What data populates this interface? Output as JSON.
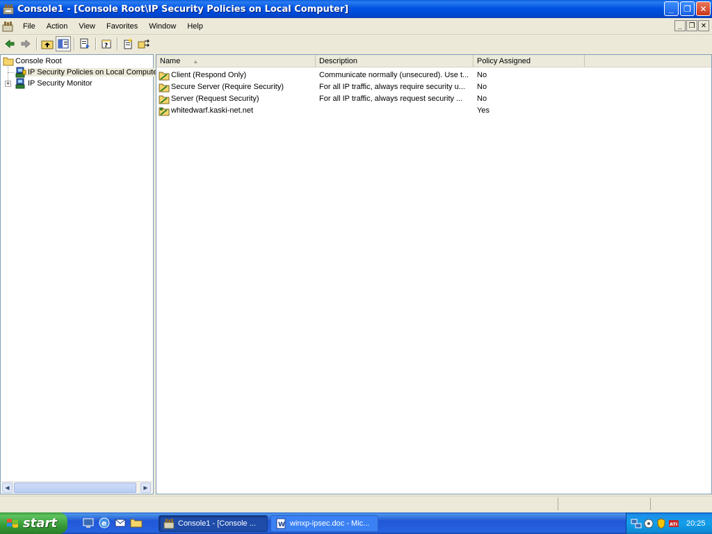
{
  "window": {
    "title": "Console1 - [Console Root\\IP Security Policies on Local Computer]",
    "buttons": {
      "minimize": "_",
      "maximize": "❐",
      "close": "✕"
    }
  },
  "menu": {
    "items": [
      "File",
      "Action",
      "View",
      "Favorites",
      "Window",
      "Help"
    ],
    "child_buttons": {
      "minimize": "_",
      "restore": "❐",
      "close": "✕"
    }
  },
  "toolbar": {
    "icons": [
      "back-icon",
      "forward-icon",
      "up-level-icon",
      "show-hide-tree-icon",
      "export-list-icon",
      "help-icon",
      "create-policy-icon",
      "manage-filters-icon"
    ]
  },
  "tree": {
    "items": [
      {
        "label": "Console Root",
        "icon": "folder-icon"
      },
      {
        "label": "IP Security Policies on Local Compute",
        "icon": "ipsec-policies-icon",
        "selected": true
      },
      {
        "label": "IP Security Monitor",
        "icon": "ipsec-monitor-icon",
        "expander": "+"
      }
    ]
  },
  "list": {
    "columns": [
      {
        "label": "Name",
        "sort": "▲"
      },
      {
        "label": "Description"
      },
      {
        "label": "Policy Assigned"
      }
    ],
    "rows": [
      {
        "name": "Client (Respond Only)",
        "description": "Communicate normally (unsecured). Use t...",
        "assigned": "No"
      },
      {
        "name": "Secure Server (Require Security)",
        "description": "For all IP traffic, always require security u...",
        "assigned": "No"
      },
      {
        "name": "Server (Request Security)",
        "description": "For all IP traffic, always request security ...",
        "assigned": "No"
      },
      {
        "name": "whitedwarf.kaski-net.net",
        "description": "",
        "assigned": "Yes"
      }
    ]
  },
  "taskbar": {
    "start_label": "start",
    "tasks": [
      {
        "label": "Console1 - [Console ...",
        "active": true
      },
      {
        "label": "winxp-ipsec.doc - Mic...",
        "active": false
      }
    ],
    "quick_launch": [
      "desktop-icon",
      "ie-icon",
      "outlook-icon",
      "explorer-icon"
    ],
    "tray_icons": [
      "network-icon",
      "volume-icon",
      "security-icon",
      "ati-icon"
    ],
    "clock": "20:25"
  },
  "colors": {
    "title_bar": "#0054e3",
    "taskbar": "#245edb",
    "start_button": "#3c9a3c",
    "window_bg": "#ece9d8"
  }
}
